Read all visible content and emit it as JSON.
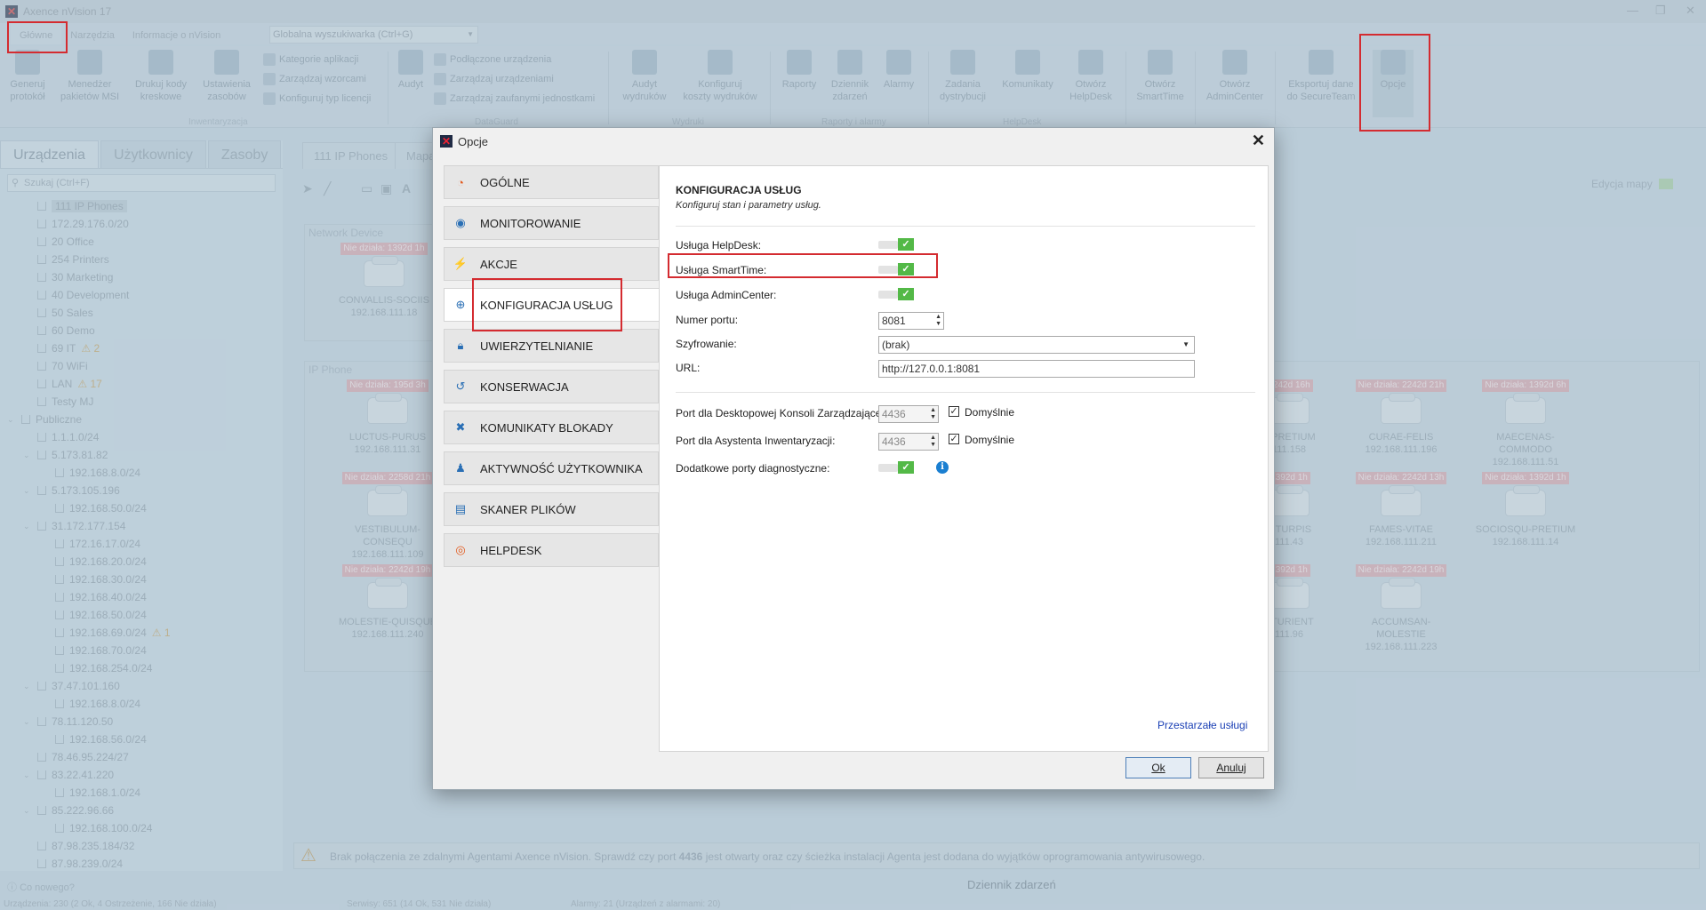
{
  "app": {
    "title": "Axence nVision 17"
  },
  "menu": {
    "tabs": [
      "Główne",
      "Narzędzia",
      "Informacje o nVision"
    ],
    "search_placeholder": "Globalna wyszukiwarka (Ctrl+G)"
  },
  "ribbon": {
    "buttons": [
      {
        "label": "Generuj\nprotokół",
        "icon": "protocol-icon"
      },
      {
        "label": "Menedżer\npakietów MSI",
        "icon": "msi-package-icon"
      },
      {
        "label": "Drukuj kody\nkreskowe",
        "icon": "barcode-print-icon"
      },
      {
        "label": "Ustawienia\nzasobów",
        "icon": "resources-settings-icon"
      },
      {
        "label": "Audyt",
        "icon": "audit-icon"
      },
      {
        "label": "Audyt\nwydruków",
        "icon": "print-audit-icon"
      },
      {
        "label": "Konfiguruj\nkoszty wydruków",
        "icon": "print-cost-icon"
      },
      {
        "label": "Raporty",
        "icon": "reports-icon"
      },
      {
        "label": "Dziennik\nzdarzeń",
        "icon": "event-log-icon"
      },
      {
        "label": "Alarmy",
        "icon": "alarms-icon"
      },
      {
        "label": "Zadania\ndystrybucji",
        "icon": "distribution-tasks-icon"
      },
      {
        "label": "Komunikaty",
        "icon": "messages-icon"
      },
      {
        "label": "Otwórz\nHelpDesk",
        "icon": "helpdesk-icon"
      },
      {
        "label": "Otwórz\nSmartTime",
        "icon": "smarttime-icon"
      },
      {
        "label": "Otwórz\nAdminCenter",
        "icon": "admincenter-icon"
      },
      {
        "label": "Eksportuj dane\ndo SecureTeam",
        "icon": "export-secureteam-icon"
      },
      {
        "label": "Opcje",
        "icon": "options-gear-icon"
      }
    ],
    "small_items": [
      "Kategorie aplikacji",
      "Zarządzaj wzorcami",
      "Konfiguruj typ licencji",
      "Podłączone urządzenia",
      "Zarządzaj urządzeniami",
      "Zarządzaj zaufanymi jednostkami"
    ],
    "groups": [
      "Inwentaryzacja",
      "DataGuard",
      "Wydruki",
      "Raporty i alarmy",
      "HelpDesk"
    ]
  },
  "leftpanel": {
    "tabs": [
      "Urządzenia",
      "Użytkownicy",
      "Zasoby"
    ],
    "search_placeholder": "Szukaj (Ctrl+F)",
    "tree": [
      {
        "label": "111 IP Phones",
        "indent": 1,
        "selected": true
      },
      {
        "label": "172.29.176.0/20",
        "indent": 1
      },
      {
        "label": "20 Office",
        "indent": 1
      },
      {
        "label": "254 Printers",
        "indent": 1
      },
      {
        "label": "30 Marketing",
        "indent": 1
      },
      {
        "label": "40 Development",
        "indent": 1
      },
      {
        "label": "50 Sales",
        "indent": 1
      },
      {
        "label": "60 Demo",
        "indent": 1
      },
      {
        "label": "69 IT",
        "indent": 1,
        "warn": "2"
      },
      {
        "label": "70 WiFi",
        "indent": 1
      },
      {
        "label": "LAN",
        "indent": 1,
        "warn": "17"
      },
      {
        "label": "Testy MJ",
        "indent": 1
      },
      {
        "label": "Publiczne",
        "indent": 0,
        "expand": true,
        "folder": true
      },
      {
        "label": "1.1.1.0/24",
        "indent": 1
      },
      {
        "label": "5.173.81.82",
        "indent": 1,
        "expand": true
      },
      {
        "label": "192.168.8.0/24",
        "indent": 2
      },
      {
        "label": "5.173.105.196",
        "indent": 1,
        "expand": true
      },
      {
        "label": "192.168.50.0/24",
        "indent": 2
      },
      {
        "label": "31.172.177.154",
        "indent": 1,
        "expand": true
      },
      {
        "label": "172.16.17.0/24",
        "indent": 2
      },
      {
        "label": "192.168.20.0/24",
        "indent": 2
      },
      {
        "label": "192.168.30.0/24",
        "indent": 2
      },
      {
        "label": "192.168.40.0/24",
        "indent": 2
      },
      {
        "label": "192.168.50.0/24",
        "indent": 2
      },
      {
        "label": "192.168.69.0/24",
        "indent": 2,
        "warn": "1"
      },
      {
        "label": "192.168.70.0/24",
        "indent": 2
      },
      {
        "label": "192.168.254.0/24",
        "indent": 2
      },
      {
        "label": "37.47.101.160",
        "indent": 1,
        "expand": true
      },
      {
        "label": "192.168.8.0/24",
        "indent": 2
      },
      {
        "label": "78.11.120.50",
        "indent": 1,
        "expand": true
      },
      {
        "label": "192.168.56.0/24",
        "indent": 2
      },
      {
        "label": "78.46.95.224/27",
        "indent": 1
      },
      {
        "label": "83.22.41.220",
        "indent": 1,
        "expand": true
      },
      {
        "label": "192.168.1.0/24",
        "indent": 2
      },
      {
        "label": "85.222.96.66",
        "indent": 1,
        "expand": true
      },
      {
        "label": "192.168.100.0/24",
        "indent": 2
      },
      {
        "label": "87.98.235.184/32",
        "indent": 1
      },
      {
        "label": "87.98.239.0/24",
        "indent": 1
      }
    ],
    "footer": "Co nowego?"
  },
  "main": {
    "tabs": [
      "111 IP Phones",
      "Mapa"
    ],
    "map_edit_label": "Edycja mapy",
    "groups": [
      "Network Device",
      "IP Phone"
    ],
    "devices": [
      {
        "tag": "Nie działa: 1392d 1h",
        "name": "CONVALLIS-SOCIIS",
        "ip": "192.168.111.18"
      },
      {
        "tag": "Nie działa: 195d 3h",
        "name": "LUCTUS-PURUS",
        "ip": "192.168.111.31"
      },
      {
        "tag": "Nie działa: 2258d 21h",
        "name": "VESTIBULUM-CONSEQU",
        "ip": "192.168.111.109"
      },
      {
        "tag": "Nie działa: 2242d 19h",
        "name": "MOLESTIE-QUISQUE",
        "ip": "192.168.111.240"
      },
      {
        "tag": "2242d 16h",
        "name": "T-PRETIUM",
        "ip": "111.158"
      },
      {
        "tag": "Nie działa: 2242d 21h",
        "name": "CURAE-FELIS",
        "ip": "192.168.111.196"
      },
      {
        "tag": "Nie działa: 1392d 6h",
        "name": "MAECENAS-COMMODO",
        "ip": "192.168.111.51"
      },
      {
        "tag": "1392d 1h",
        "name": "T-TURPIS",
        "ip": "111.43"
      },
      {
        "tag": "Nie działa: 2242d 13h",
        "name": "FAMES-VITAE",
        "ip": "192.168.111.211"
      },
      {
        "tag": "Nie działa: 1392d 1h",
        "name": "SOCIOSQU-PRETIUM",
        "ip": "192.168.111.14"
      },
      {
        "tag": "1392d 1h",
        "name": "RTURIENT",
        "ip": "111.96"
      },
      {
        "tag": "Nie działa: 2242d 19h",
        "name": "ACCUMSAN-MOLESTIE",
        "ip": "192.168.111.223"
      }
    ],
    "message_pre": "Brak połączenia ze zdalnymi Agentami Axence nVision. Sprawdź czy port ",
    "message_port": "4436",
    "message_post": " jest otwarty oraz czy ścieżka instalacji Agenta jest dodana do wyjątków oprogramowania antywirusowego.",
    "event_log_label": "Dziennik zdarzeń"
  },
  "statusbar": {
    "devices": "Urządzenia: 230 (2 Ok, 4 Ostrzeżenie, 166 Nie działa)",
    "services": "Serwisy: 651 (14 Ok, 531 Nie działa)",
    "alarms": "Alarmy: 21 (Urządzeń z alarmami: 20)"
  },
  "dialog": {
    "title": "Opcje",
    "nav": [
      {
        "label": "OGÓLNE",
        "icon": "general-chart-icon"
      },
      {
        "label": "MONITOROWANIE",
        "icon": "monitoring-eye-icon"
      },
      {
        "label": "AKCJE",
        "icon": "actions-bolt-icon"
      },
      {
        "label": "KONFIGURACJA USŁUG",
        "icon": "services-globe-icon",
        "active": true
      },
      {
        "label": "UWIERZYTELNIANIE",
        "icon": "auth-lock-icon"
      },
      {
        "label": "KONSERWACJA",
        "icon": "maintenance-history-icon"
      },
      {
        "label": "KOMUNIKATY BLOKADY",
        "icon": "block-messages-icon"
      },
      {
        "label": "AKTYWNOŚĆ UŻYTKOWNIKA",
        "icon": "user-activity-icon"
      },
      {
        "label": "SKANER PLIKÓW",
        "icon": "file-scanner-icon"
      },
      {
        "label": "HELPDESK",
        "icon": "helpdesk-lifebuoy-icon"
      }
    ],
    "section_title": "KONFIGURACJA USŁUG",
    "section_subtitle": "Konfiguruj stan i parametry usług.",
    "fields": {
      "helpdesk_label": "Usługa HelpDesk:",
      "smarttime_label": "Usługa SmartTime:",
      "admincenter_label": "Usługa AdminCenter:",
      "port_label": "Numer portu:",
      "port_value": "8081",
      "encryption_label": "Szyfrowanie:",
      "encryption_value": "(brak)",
      "url_label": "URL:",
      "url_value": "http://127.0.0.1:8081",
      "console_port_label": "Port dla Desktopowej Konsoli Zarządzające",
      "console_port_value": "4436",
      "inventory_port_label": "Port dla Asystenta Inwentaryzacji:",
      "inventory_port_value": "4436",
      "default_label": "Domyślnie",
      "diag_ports_label": "Dodatkowe porty diagnostyczne:"
    },
    "toggles": {
      "helpdesk": true,
      "smarttime": true,
      "admincenter": true,
      "diag_ports": true
    },
    "deprecated_link": "Przestarzałe usługi",
    "ok": "Ok",
    "cancel": "Anuluj"
  }
}
